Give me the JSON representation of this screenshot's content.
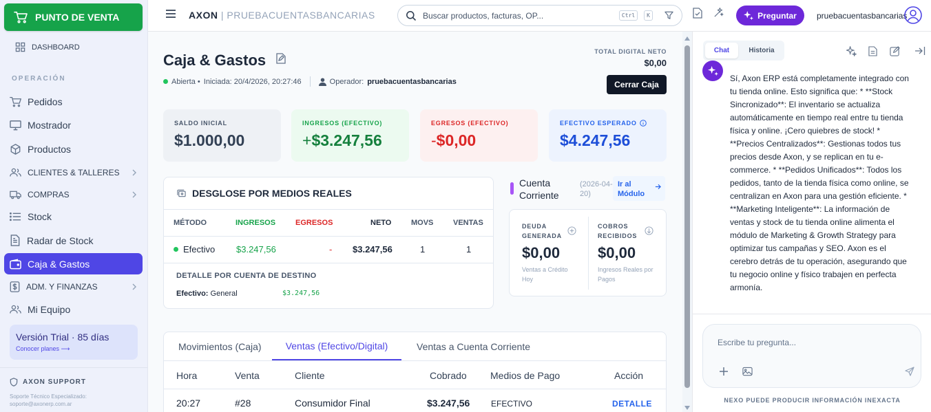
{
  "sidebar": {
    "pos_button": "PUNTO DE VENTA",
    "dashboard": "DASHBOARD",
    "section_title": "OPERACIÓN",
    "items": [
      {
        "label": "Pedidos",
        "icon": "cart-icon"
      },
      {
        "label": "Mostrador",
        "icon": "monitor-icon"
      },
      {
        "label": "Productos",
        "icon": "box-icon"
      },
      {
        "label": "CLIENTES & TALLERES",
        "icon": "users-icon",
        "expandable": true
      },
      {
        "label": "COMPRAS",
        "icon": "truck-icon",
        "expandable": true
      },
      {
        "label": "Stock",
        "icon": "list-icon"
      },
      {
        "label": "Radar de Stock",
        "icon": "document-icon"
      },
      {
        "label": "Caja & Gastos",
        "icon": "wallet-icon",
        "active": true
      },
      {
        "label": "ADM. Y FINANZAS",
        "icon": "dollar-icon",
        "expandable": true
      },
      {
        "label": "Mi Equipo",
        "icon": "team-icon"
      }
    ],
    "trial": {
      "title": "Versión Trial · 85 días",
      "link": "Conocer planes ⟶"
    },
    "support": {
      "title": "AXON SUPPORT",
      "line1": "Soporte Técnico Especializado:",
      "email": "soporte@axonerp.com.ar"
    }
  },
  "header": {
    "brand": "AXON",
    "tenant": "| PRUEBACUENTASBANCARIAS",
    "search_placeholder": "Buscar productos, facturas, OP...",
    "kbd_ctrl": "Ctrl",
    "kbd_k": "K",
    "ask_button": "Preguntar",
    "username": "pruebacuentasbancarias"
  },
  "page": {
    "title": "Caja & Gastos",
    "status": "Abierta •",
    "started": "Iniciada: 20/4/2026, 20:27:46",
    "operator_label": "Operador:",
    "operator": "pruebacuentasbancarias",
    "total_digital_label": "TOTAL DIGITAL NETO",
    "total_digital_value": "$0,00",
    "close_button": "Cerrar Caja"
  },
  "cards": {
    "saldo": {
      "label": "SALDO INICIAL",
      "value": "$1.000,00"
    },
    "ingresos": {
      "label": "INGRESOS (EFECTIVO)",
      "prefix": "+",
      "value": "$3.247,56"
    },
    "egresos": {
      "label": "EGRESOS (EFECTIVO)",
      "prefix": "-",
      "value": "$0,00"
    },
    "esperado": {
      "label": "EFECTIVO ESPERADO",
      "value": "$4.247,56"
    }
  },
  "breakdown": {
    "title": "DESGLOSE POR MEDIOS REALES",
    "headers": {
      "metodo": "MÉTODO",
      "ingresos": "INGRESOS",
      "egresos": "EGRESOS",
      "neto": "NETO",
      "movs": "MOVS",
      "ventas": "VENTAS"
    },
    "row": {
      "metodo": "Efectivo",
      "ingresos": "$3.247,56",
      "egresos": "-",
      "neto": "$3.247,56",
      "movs": "1",
      "ventas": "1"
    },
    "detail_title": "DETALLE POR CUENTA DE DESTINO",
    "detail_label": "Efectivo:",
    "detail_account": "General",
    "detail_value": "$3.247,56"
  },
  "cuenta_corriente": {
    "title_line1": "Cuenta",
    "title_line2": "Corriente",
    "date_line1": "(2026-04-",
    "date_line2": "20)",
    "link_line1": "Ir al",
    "link_line2": "Módulo",
    "deuda": {
      "label1": "DEUDA",
      "label2": "GENERADA",
      "value": "$0,00",
      "sub1": "Ventas a Crédito",
      "sub2": "Hoy"
    },
    "cobros": {
      "label1": "COBROS",
      "label2": "RECIBIDOS",
      "value": "$0,00",
      "sub1": "Ingresos Reales por",
      "sub2": "Pagos"
    }
  },
  "tabs": {
    "items": [
      "Movimientos (Caja)",
      "Ventas (Efectivo/Digital)",
      "Ventas a Cuenta Corriente"
    ],
    "active": 1,
    "headers": {
      "hora": "Hora",
      "venta": "Venta",
      "cliente": "Cliente",
      "cobrado": "Cobrado",
      "medios": "Medios de Pago",
      "accion": "Acción"
    },
    "rows": [
      {
        "hora": "20:27",
        "venta": "#28",
        "cliente": "Consumidor Final",
        "cobrado": "$3.247,56",
        "medios": "EFECTIVO",
        "accion": "DETALLE"
      }
    ]
  },
  "chat": {
    "tab_chat": "Chat",
    "tab_history": "Historia",
    "message": "Sí, Axon ERP está completamente integrado con tu tienda online. Esto significa que: * **Stock Sincronizado**: El inventario se actualiza automáticamente en tiempo real entre tu tienda física y online. ¡Cero quiebres de stock! * **Precios Centralizados**: Gestionas todos tus precios desde Axon, y se replican en tu e-commerce. * **Pedidos Unificados**: Todos los pedidos, tanto de la tienda física como online, se centralizan en Axon para una gestión eficiente. * **Marketing Inteligente**: La información de ventas y stock de tu tienda online alimenta el módulo de Marketing & Growth Strategy para optimizar tus campañas y SEO. Axon es el cerebro detrás de tu operación, asegurando que tu negocio online y físico trabajen en perfecta armonía.",
    "input_placeholder": "Escribe tu pregunta...",
    "disclaimer": "NEXO PUEDE PRODUCIR INFORMACIÓN INEXACTA"
  },
  "colors": {
    "primary": "#4f46e5",
    "pos_green": "#16a34a",
    "ask_purple": "#6d28d9",
    "income_green": "#16a34a",
    "expense_red": "#dc2626",
    "expected_blue": "#1d4ed8"
  }
}
